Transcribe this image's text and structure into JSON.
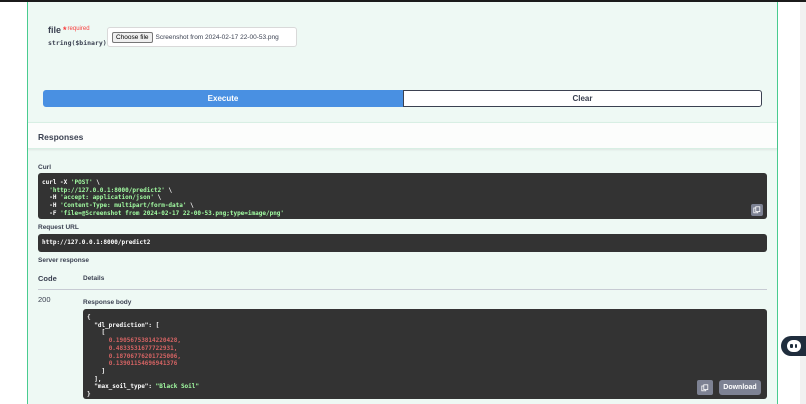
{
  "param": {
    "name": "file",
    "required_star": "*",
    "required_label": "required",
    "type": "string($binary)",
    "choose_button": "Choose file",
    "filename": "Screenshot from 2024-02-17 22-00-53.png"
  },
  "actions": {
    "execute_label": "Execute",
    "clear_label": "Clear"
  },
  "responses": {
    "title": "Responses",
    "curl_label": "Curl",
    "curl_lines": [
      [
        "curl -X ",
        "'POST'",
        " \\"
      ],
      [
        "  ",
        "'http://127.0.0.1:8000/predict2'",
        " \\"
      ],
      [
        "  -H ",
        "'accept: application/json'",
        " \\"
      ],
      [
        "  -H ",
        "'Content-Type: multipart/form-data'",
        " \\"
      ],
      [
        "  -F ",
        "'file=@Screenshot from 2024-02-17 22-00-53.png;type=image/png'",
        ""
      ]
    ],
    "request_url_label": "Request URL",
    "request_url": "http://127.0.0.1:8000/predict2",
    "server_response_label": "Server response",
    "col_code": "Code",
    "col_details": "Details",
    "status_code": "200",
    "response_body_label": "Response body",
    "body": {
      "open_brace": "{",
      "key_dl": "\"dl_prediction\": [",
      "inner_open": "[",
      "values": [
        "0.19056753814220428,",
        "0.4833531677722931,",
        "0.18706776201725006,",
        "0.13901154696941376"
      ],
      "inner_close": "]",
      "outer_close": "],",
      "key_soil": "\"max_soil_type\": ",
      "soil_value": "\"Black Soil\"",
      "close_brace": "}"
    },
    "download_label": "Download"
  },
  "icons": {
    "copy": "copy-icon",
    "chat": "chat-bot-icon"
  },
  "colors": {
    "accent_green": "#49cc90",
    "execute_blue": "#4990e2",
    "code_bg": "#333333"
  }
}
